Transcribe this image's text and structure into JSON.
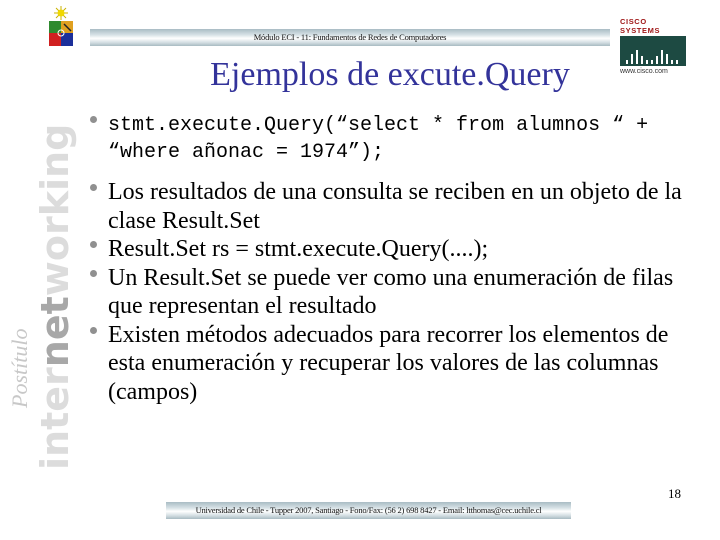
{
  "header": {
    "module_text": "Módulo ECI - 11: Fundamentos de Redes de Computadores"
  },
  "logos": {
    "crest_icon": "university-crest-icon",
    "cisco_name": "CISCO SYSTEMS",
    "cisco_url": "www.cisco.com"
  },
  "sidebar": {
    "postitulo": "Postítulo",
    "inter": "inter",
    "net": "net",
    "working": "working"
  },
  "slide": {
    "title": "Ejemplos de excute.Query",
    "bullets": [
      {
        "style": "code",
        "text": "stmt.execute.Query(“select * from alumnos “ + “where añonac = 1974”);"
      },
      {
        "style": "text",
        "text": "Los resultados de una consulta se reciben en un objeto de la clase Result.Set"
      },
      {
        "style": "text",
        "text": "Result.Set rs = stmt.execute.Query(....);"
      },
      {
        "style": "text",
        "text": "Un Result.Set se puede ver como una enumeración de filas que representan el resultado"
      },
      {
        "style": "text",
        "text": "Existen métodos adecuados para recorrer los elementos de esta enumeración y recuperar los valores de las columnas (campos)"
      }
    ],
    "page_number": "18"
  },
  "footer": {
    "text": "Universidad de Chile - Tupper 2007, Santiago - Fono/Fax: (56 2) 698 8427 - Email: ltthomas@cec.uchile.cl"
  }
}
